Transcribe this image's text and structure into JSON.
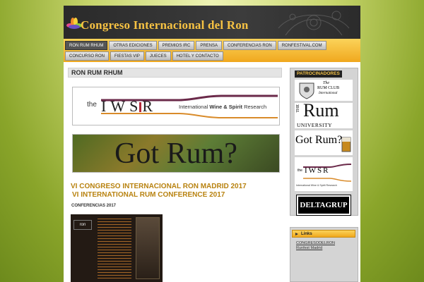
{
  "header": {
    "site_title": "Congreso Internacional del Ron"
  },
  "nav": {
    "row1": [
      "RON RUM RHUM",
      "OTRAS EDICIONES",
      "PREMIOS IRC",
      "PRENSA",
      "CONFERENCIAS RON",
      "RONFESTIVAL.COM"
    ],
    "row2": [
      "CONCURSO RON",
      "FIESTAS VIP",
      "JUECES",
      "HOTEL Y CONTACTO"
    ],
    "active": "RON RUM RHUM"
  },
  "main": {
    "heading": "RON RUM RHUM",
    "iwsr_banner": {
      "prefix": "the",
      "name": "IWSR",
      "tagline_a": "International ",
      "tagline_b": "Wine & Spirit",
      "tagline_c": " Research"
    },
    "gotrum_banner": "Got Rum?",
    "congress_title_line1": "VI CONGRESO INTERNACIONAL RON MADRID 2017",
    "congress_title_line2": "VI INTERNATIONAL RUM CONFERENCE 2017",
    "sub_heading": "CONFERENCIAS 2017",
    "poster": {
      "left_title": "ron"
    }
  },
  "sidebar": {
    "sponsors_label": "PATROCINADORES",
    "club_line1": "The",
    "club_line2": "RUM CLUB",
    "club_line3": "International",
    "rumuni_the": "THE",
    "rumuni_rum": "Rum",
    "rumuni_university": "UNIVERSITY",
    "gotrum": "Got Rum?",
    "iwsr_prefix": "the",
    "iwsr_name": "IWSR",
    "iwsr_tagline": "International Wine & Spirit Research",
    "deltagrup": "DELTAGRUP",
    "links_header": "Links",
    "links": [
      "CONGRESODELRON",
      "Runfest Madrid"
    ]
  },
  "colors": {
    "title_gold": "#f6c243",
    "nav_orange": "#f0a81e",
    "congress_title": "#b8820f"
  }
}
